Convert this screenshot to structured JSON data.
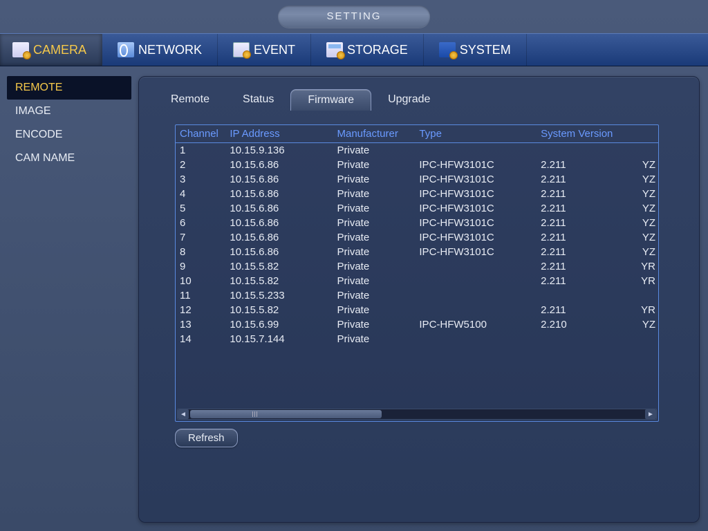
{
  "title": "SETTING",
  "nav": [
    {
      "label": "CAMERA",
      "active": true
    },
    {
      "label": "NETWORK",
      "active": false
    },
    {
      "label": "EVENT",
      "active": false
    },
    {
      "label": "STORAGE",
      "active": false
    },
    {
      "label": "SYSTEM",
      "active": false
    }
  ],
  "sidebar": [
    {
      "label": "REMOTE",
      "active": true
    },
    {
      "label": "IMAGE",
      "active": false
    },
    {
      "label": "ENCODE",
      "active": false
    },
    {
      "label": "CAM NAME",
      "active": false
    }
  ],
  "subtabs": [
    {
      "label": "Remote",
      "active": false
    },
    {
      "label": "Status",
      "active": false
    },
    {
      "label": "Firmware",
      "active": true
    },
    {
      "label": "Upgrade",
      "active": false
    }
  ],
  "table": {
    "headers": [
      "Channel",
      "IP Address",
      "Manufacturer",
      "Type",
      "System Version",
      ""
    ],
    "rows": [
      {
        "channel": "1",
        "ip": "10.15.9.136",
        "manufacturer": "Private",
        "type": "",
        "system_version": "",
        "extra": ""
      },
      {
        "channel": "2",
        "ip": "10.15.6.86",
        "manufacturer": "Private",
        "type": "IPC-HFW3101C",
        "system_version": "2.211",
        "extra": "YZ"
      },
      {
        "channel": "3",
        "ip": "10.15.6.86",
        "manufacturer": "Private",
        "type": "IPC-HFW3101C",
        "system_version": "2.211",
        "extra": "YZ"
      },
      {
        "channel": "4",
        "ip": "10.15.6.86",
        "manufacturer": "Private",
        "type": "IPC-HFW3101C",
        "system_version": "2.211",
        "extra": "YZ"
      },
      {
        "channel": "5",
        "ip": "10.15.6.86",
        "manufacturer": "Private",
        "type": "IPC-HFW3101C",
        "system_version": "2.211",
        "extra": "YZ"
      },
      {
        "channel": "6",
        "ip": "10.15.6.86",
        "manufacturer": "Private",
        "type": "IPC-HFW3101C",
        "system_version": "2.211",
        "extra": "YZ"
      },
      {
        "channel": "7",
        "ip": "10.15.6.86",
        "manufacturer": "Private",
        "type": "IPC-HFW3101C",
        "system_version": "2.211",
        "extra": "YZ"
      },
      {
        "channel": "8",
        "ip": "10.15.6.86",
        "manufacturer": "Private",
        "type": "IPC-HFW3101C",
        "system_version": "2.211",
        "extra": "YZ"
      },
      {
        "channel": "9",
        "ip": "10.15.5.82",
        "manufacturer": "Private",
        "type": "",
        "system_version": "2.211",
        "extra": "YR"
      },
      {
        "channel": "10",
        "ip": "10.15.5.82",
        "manufacturer": "Private",
        "type": "",
        "system_version": "2.211",
        "extra": "YR"
      },
      {
        "channel": "11",
        "ip": "10.15.5.233",
        "manufacturer": "Private",
        "type": "",
        "system_version": "",
        "extra": ""
      },
      {
        "channel": "12",
        "ip": "10.15.5.82",
        "manufacturer": "Private",
        "type": "",
        "system_version": "2.211",
        "extra": "YR"
      },
      {
        "channel": "13",
        "ip": "10.15.6.99",
        "manufacturer": "Private",
        "type": "IPC-HFW5100",
        "system_version": "2.210",
        "extra": "YZ"
      },
      {
        "channel": "14",
        "ip": "10.15.7.144",
        "manufacturer": "Private",
        "type": "",
        "system_version": "",
        "extra": ""
      }
    ]
  },
  "buttons": {
    "refresh": "Refresh"
  }
}
